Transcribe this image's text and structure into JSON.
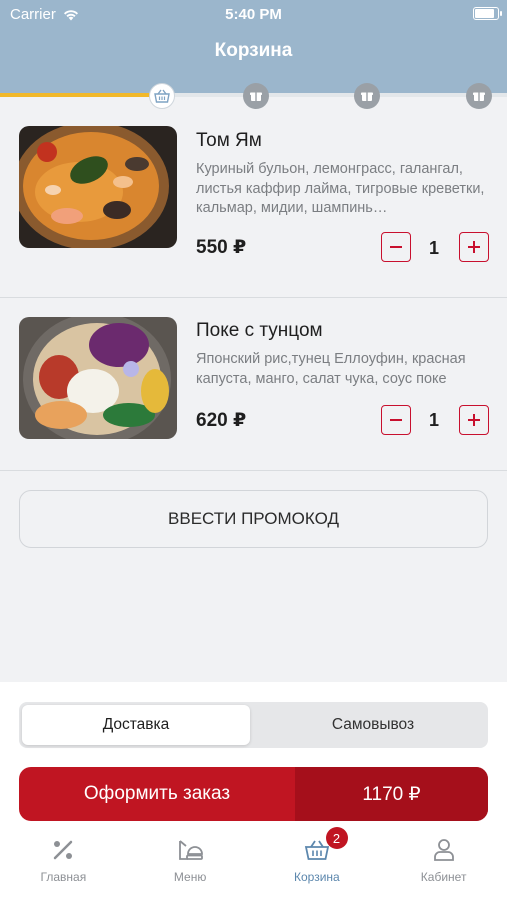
{
  "status_bar": {
    "carrier": "Carrier",
    "time": "5:40 PM"
  },
  "header": {
    "title": "Корзина"
  },
  "progress": {
    "fraction": 0.32,
    "current_step": 1,
    "step_count": 4
  },
  "items": [
    {
      "title": "Том Ям",
      "description": "Куриный бульон, лемонграсс, галангал, листья каффир лайма, тигровые креветки, кальмар, мидии, шампинь…",
      "price": "550 ₽",
      "quantity": "1"
    },
    {
      "title": "Поке с тунцом",
      "description": "Японский рис,тунец Еллоуфин, красная капуста, манго, салат чука, соус поке",
      "price": "620 ₽",
      "quantity": "1"
    }
  ],
  "promo": {
    "label": "ВВЕСТИ ПРОМОКОД"
  },
  "delivery": {
    "options": [
      "Доставка",
      "Самовывоз"
    ],
    "selected": "Доставка"
  },
  "checkout": {
    "label": "Оформить заказ",
    "total": "1170 ₽"
  },
  "tabbar": {
    "tabs": [
      {
        "label": "Главная",
        "icon": "percent-icon"
      },
      {
        "label": "Меню",
        "icon": "food-menu-icon"
      },
      {
        "label": "Корзина",
        "icon": "basket-icon",
        "badge": "2"
      },
      {
        "label": "Кабинет",
        "icon": "person-icon"
      }
    ],
    "active": "Корзина"
  },
  "colors": {
    "header": "#9bb6cc",
    "accent": "#c01522",
    "accent_dark": "#a50f1b",
    "progress": "#f1b82a",
    "active_tab": "#5c87ad"
  }
}
